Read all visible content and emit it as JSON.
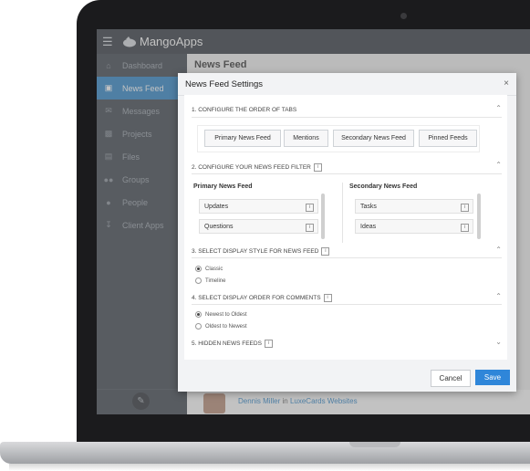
{
  "app": {
    "logo_text": "MangoApps"
  },
  "sidebar": {
    "items": [
      {
        "label": "Dashboard",
        "icon": "home-icon"
      },
      {
        "label": "News Feed",
        "icon": "inbox-icon",
        "active": true
      },
      {
        "label": "Messages",
        "icon": "mail-icon"
      },
      {
        "label": "Projects",
        "icon": "briefcase-icon"
      },
      {
        "label": "Files",
        "icon": "files-icon"
      },
      {
        "label": "Groups",
        "icon": "groups-icon"
      },
      {
        "label": "People",
        "icon": "person-icon"
      },
      {
        "label": "Client Apps",
        "icon": "download-icon"
      }
    ]
  },
  "main": {
    "title": "News Feed",
    "post": {
      "author": "Dennis Miller",
      "in": "in",
      "group": "LuxeCards Websites"
    }
  },
  "modal": {
    "title": "News Feed Settings",
    "close": "×",
    "section1": {
      "heading": "1. CONFIGURE THE ORDER OF TABS",
      "tabs": [
        "Primary News Feed",
        "Mentions",
        "Secondary News Feed",
        "Pinned Feeds"
      ]
    },
    "section2": {
      "heading": "2. CONFIGURE YOUR NEWS FEED FILTER",
      "primary_heading": "Primary News Feed",
      "primary_items": [
        "Updates",
        "Questions"
      ],
      "secondary_heading": "Secondary News Feed",
      "secondary_items": [
        "Tasks",
        "Ideas"
      ]
    },
    "section3": {
      "heading": "3. SELECT DISPLAY STYLE FOR NEWS FEED",
      "options": [
        "Classic",
        "Timeline"
      ],
      "selected": "Classic"
    },
    "section4": {
      "heading": "4. SELECT DISPLAY ORDER FOR COMMENTS",
      "options": [
        "Newest to Oldest",
        "Oldest to Newest"
      ],
      "selected": "Newest to Oldest"
    },
    "section5": {
      "heading": "5. HIDDEN NEWS FEEDS"
    },
    "info_glyph": "i",
    "cancel_label": "Cancel",
    "save_label": "Save"
  },
  "colors": {
    "accent": "#2f86d9",
    "sidebar": "#3f464f",
    "topbar": "#343a42"
  }
}
